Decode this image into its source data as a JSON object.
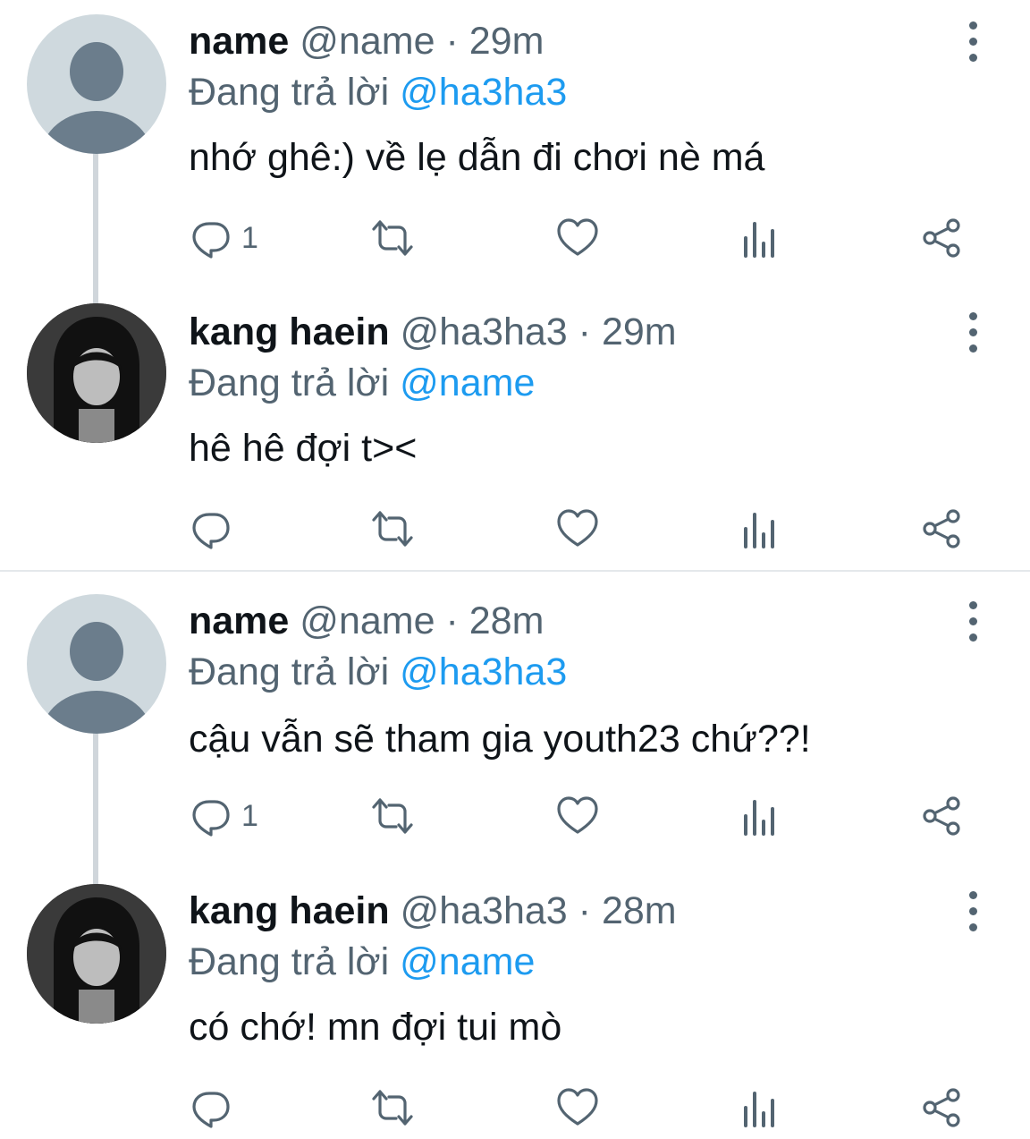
{
  "tweets": [
    {
      "name": "name",
      "handle": "@name",
      "sep": "·",
      "time": "29m",
      "reply_prefix": "Đang trả lời",
      "reply_to": "@ha3ha3",
      "text": "nhớ ghê:) về lẹ dẫn đi chơi nè má",
      "reply_count": "1",
      "avatar": "default-avatar"
    },
    {
      "name": "kang haein",
      "handle": "@ha3ha3",
      "sep": "·",
      "time": "29m",
      "reply_prefix": "Đang trả lời",
      "reply_to": "@name",
      "text": "hê hê đợi t><",
      "reply_count": "",
      "avatar": "anime-girl-photo"
    },
    {
      "name": "name",
      "handle": "@name",
      "sep": "·",
      "time": "28m",
      "reply_prefix": "Đang trả lời",
      "reply_to": "@ha3ha3",
      "text": "cậu vẫn sẽ tham gia youth23 chứ??!",
      "reply_count": "1",
      "avatar": "default-avatar"
    },
    {
      "name": "kang haein",
      "handle": "@ha3ha3",
      "sep": "·",
      "time": "28m",
      "reply_prefix": "Đang trả lời",
      "reply_to": "@name",
      "text": "có chớ! mn đợi tui mò",
      "reply_count": "",
      "avatar": "anime-girl-photo"
    }
  ],
  "colors": {
    "text": "#0f1419",
    "secondary": "#536471",
    "mention": "#1d9bf0",
    "thread_line": "#d0d6db",
    "avatar_default_bg": "#cfd9de",
    "avatar_default_fg": "#6b7d8c"
  },
  "icons": [
    "reply-icon",
    "retweet-icon",
    "like-icon",
    "views-icon",
    "share-icon",
    "more-icon"
  ]
}
